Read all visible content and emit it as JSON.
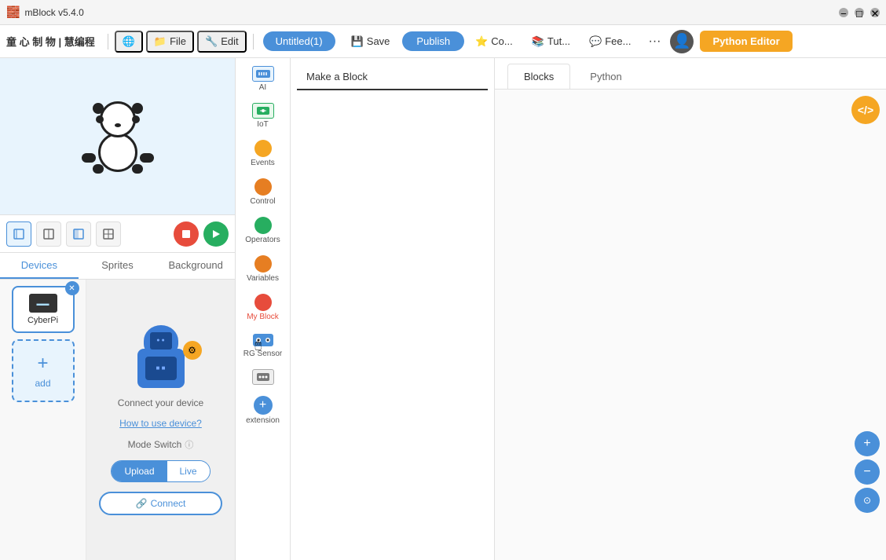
{
  "titlebar": {
    "app_name": "mBlock v5.4.0",
    "minimize_label": "−",
    "maximize_label": "□",
    "close_label": "✕"
  },
  "menubar": {
    "logo_text": "童 心 制 物 | 慧编程",
    "globe_icon": "🌐",
    "file_label": "File",
    "edit_label": "Edit",
    "project_name": "Untitled(1)",
    "save_label": "Save",
    "publish_label": "Publish",
    "co_label": "Co...",
    "tut_label": "Tut...",
    "fee_label": "Fee...",
    "more_label": "···",
    "python_editor_label": "Python Editor"
  },
  "stage": {
    "panda_emoji": "🐼"
  },
  "stage_controls": {
    "stop_color": "#e74c3c",
    "run_color": "#27ae60"
  },
  "tabs": {
    "devices": "Devices",
    "sprites": "Sprites",
    "background": "Background"
  },
  "device": {
    "name": "CyberPi",
    "connect_text": "Connect your device",
    "how_to_label": "How to use device?",
    "mode_switch_label": "Mode Switch",
    "upload_label": "Upload",
    "live_label": "Live",
    "connect_btn_label": "Connect",
    "add_label": "add"
  },
  "block_categories": [
    {
      "key": "ai",
      "label": "AI",
      "type": "icon",
      "color": "#4a90d9"
    },
    {
      "key": "iot",
      "label": "IoT",
      "type": "icon",
      "color": "#27ae60"
    },
    {
      "key": "events",
      "label": "Events",
      "type": "dot",
      "color": "#f5a623"
    },
    {
      "key": "control",
      "label": "Control",
      "type": "dot",
      "color": "#e67e22"
    },
    {
      "key": "operators",
      "label": "Operators",
      "type": "dot",
      "color": "#27ae60"
    },
    {
      "key": "variables",
      "label": "Variables",
      "type": "dot",
      "color": "#e67e22"
    },
    {
      "key": "my-block",
      "label": "My Block",
      "type": "dot",
      "color": "#e74c3c"
    },
    {
      "key": "rg-sensor",
      "label": "RG Sensor",
      "type": "icon",
      "color": "#4a90d9"
    },
    {
      "key": "extra",
      "label": "",
      "type": "icon",
      "color": "#555"
    },
    {
      "key": "extension",
      "label": "extension",
      "type": "add",
      "color": "#4a90d9"
    }
  ],
  "make_block": {
    "tab_label": "Make a Block"
  },
  "workspace_tabs": {
    "blocks_label": "Blocks",
    "python_label": "Python"
  },
  "code_icon": {
    "label": "</>"
  },
  "zoom": {
    "zoom_in_label": "+",
    "zoom_out_label": "−"
  }
}
